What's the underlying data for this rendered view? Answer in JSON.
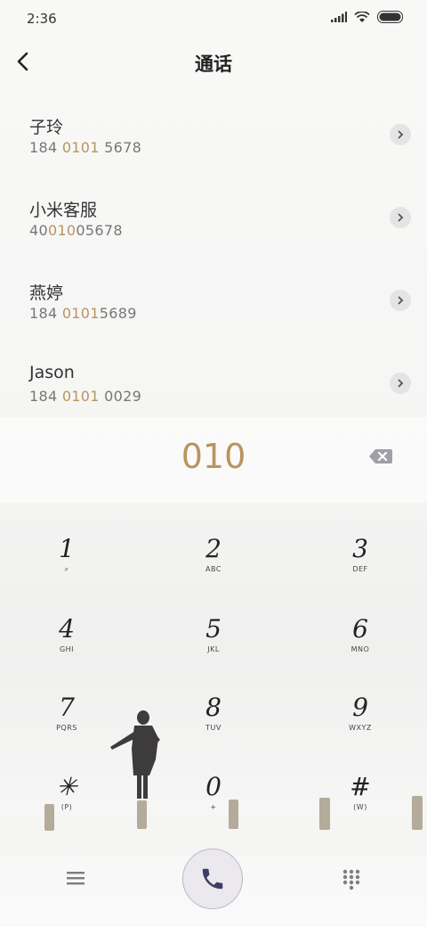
{
  "status_bar": {
    "time": "2:36"
  },
  "header": {
    "title": "通话"
  },
  "contacts": [
    {
      "name": "子玲",
      "num_pre": "184 ",
      "num_hl": "0101",
      "num_post": " 5678"
    },
    {
      "name": "小米客服",
      "num_pre": "40",
      "num_hl": "010",
      "num_post": "05678"
    },
    {
      "name": "燕婷",
      "num_pre": "184 ",
      "num_hl": "0101",
      "num_post": "5689"
    },
    {
      "name": "Jason",
      "num_pre": "184 ",
      "num_hl": "0101",
      "num_post": " 0029"
    }
  ],
  "dialer": {
    "typed_number": "010"
  },
  "keypad": [
    {
      "digit": "1",
      "sub": "⌕"
    },
    {
      "digit": "2",
      "sub": "ABC"
    },
    {
      "digit": "3",
      "sub": "DEF"
    },
    {
      "digit": "4",
      "sub": "GHI"
    },
    {
      "digit": "5",
      "sub": "JKL"
    },
    {
      "digit": "6",
      "sub": "MNO"
    },
    {
      "digit": "7",
      "sub": "PQRS"
    },
    {
      "digit": "8",
      "sub": "TUV"
    },
    {
      "digit": "9",
      "sub": "WXYZ"
    },
    {
      "digit": "✳",
      "sub": "(P)"
    },
    {
      "digit": "0",
      "sub": "+"
    },
    {
      "digit": "#",
      "sub": "(W)"
    }
  ],
  "colors": {
    "accent": "#b8955f",
    "text": "#333333",
    "call_bg": "#ebe9ee",
    "call_icon": "#3d3e62"
  },
  "icons": {
    "back": "back-arrow-icon",
    "signal": "signal-icon",
    "wifi": "wifi-icon",
    "battery": "battery-icon",
    "detail": "chevron-right-icon",
    "delete": "backspace-icon",
    "menu": "menu-icon",
    "call": "phone-icon",
    "dialpad": "dialpad-icon"
  }
}
